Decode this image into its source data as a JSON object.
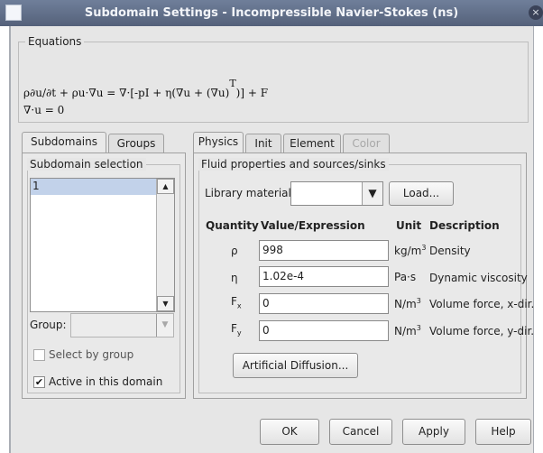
{
  "window": {
    "title": "Subdomain Settings - Incompressible Navier-Stokes (ns)",
    "close_glyph": "×"
  },
  "equations": {
    "legend": "Equations",
    "line1_main": "ρ∂u/∂t + ρu·∇u = ∇·[-pI + η(∇u + (∇u)",
    "line1_sup": "T",
    "line1_end": ")] + F",
    "line2": "∇·u = 0"
  },
  "left_tabs": [
    {
      "label": "Subdomains",
      "active": true
    },
    {
      "label": "Groups",
      "active": false
    }
  ],
  "subdomain_selection": {
    "legend": "Subdomain selection",
    "items": [
      "1"
    ],
    "selected": "1",
    "group_label": "Group:",
    "group_value": "",
    "select_by_group_label": "Select by group",
    "select_by_group_checked": false,
    "active_label": "Active in this domain",
    "active_checked": true
  },
  "right_tabs": [
    {
      "label": "Physics",
      "active": true,
      "enabled": true
    },
    {
      "label": "Init",
      "active": false,
      "enabled": true
    },
    {
      "label": "Element",
      "active": false,
      "enabled": true
    },
    {
      "label": "Color",
      "active": false,
      "enabled": false
    }
  ],
  "fluid": {
    "legend": "Fluid properties and sources/sinks",
    "library_label": "Library material:",
    "library_value": "",
    "load_label": "Load...",
    "headers": {
      "quantity": "Quantity",
      "value": "Value/Expression",
      "unit": "Unit",
      "description": "Description"
    },
    "rows": [
      {
        "symbol": "ρ",
        "sub": "",
        "value": "998",
        "unit": "kg/m",
        "unit_sup": "3",
        "description": "Density"
      },
      {
        "symbol": "η",
        "sub": "",
        "value": "1.02e-4",
        "unit": "Pa·s",
        "unit_sup": "",
        "description": "Dynamic viscosity"
      },
      {
        "symbol": "F",
        "sub": "x",
        "value": "0",
        "unit": "N/m",
        "unit_sup": "3",
        "description": "Volume force, x-dir."
      },
      {
        "symbol": "F",
        "sub": "y",
        "value": "0",
        "unit": "N/m",
        "unit_sup": "3",
        "description": "Volume force, y-dir."
      }
    ],
    "artificial_label": "Artificial Diffusion..."
  },
  "footer": {
    "ok": "OK",
    "cancel": "Cancel",
    "apply": "Apply",
    "help": "Help"
  },
  "glyphs": {
    "scroll_up": "▲",
    "scroll_down": "▼",
    "combo_arrow": "▼",
    "check": "✔"
  }
}
